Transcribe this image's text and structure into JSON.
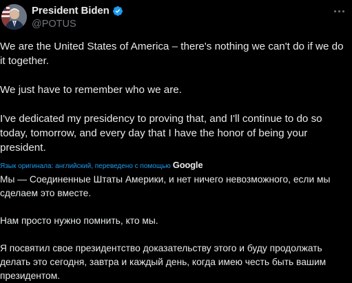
{
  "author": {
    "display_name": "President Biden",
    "handle": "@POTUS",
    "verified_color": "#1d9bf0"
  },
  "tweet": {
    "paragraph_1": "We are the United States of America – there's nothing we can't do if we do it together.",
    "paragraph_2": "We just have to remember who we are.",
    "paragraph_3": "I've dedicated my presidency to proving that, and I'll continue to do so today, tomorrow, and every day that I have the honor of being your president."
  },
  "translation": {
    "note": "Язык оригинала: английский, переведено с помощью",
    "provider": "Google",
    "paragraph_1": "Мы — Соединенные Штаты Америки, и нет ничего невозможного, если мы сделаем это вместе.",
    "paragraph_2": "Нам просто нужно помнить, кто мы.",
    "paragraph_3": "Я посвятил свое президентство доказательству этого и буду продолжать делать это сегодня, завтра и каждый день, когда имею честь быть вашим президентом."
  },
  "icons": {
    "verified": "verified-badge-icon",
    "more": "more-options-icon",
    "avatar": "avatar"
  }
}
